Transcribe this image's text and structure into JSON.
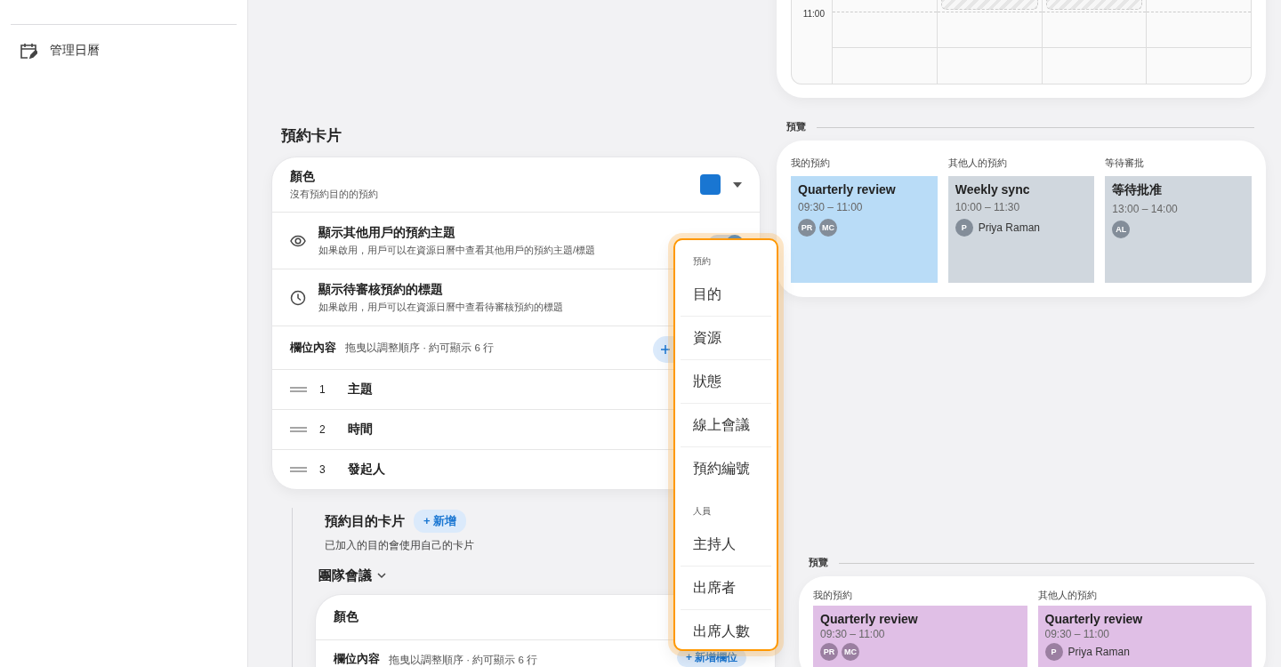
{
  "sidebar": {
    "items": [
      {
        "label": "管理日曆"
      }
    ]
  },
  "schedule": {
    "time_label": "11:00"
  },
  "booking_card": {
    "title": "預約卡片",
    "color_setting": {
      "label": "顏色",
      "description": "沒有預約目的的預約",
      "color": "#1976d2"
    },
    "toggles": [
      {
        "title": "顯示其他用戶的預約主題",
        "description": "如果啟用，用戶可以在資源日曆中查看其他用戶的預約主題/標題",
        "on": true
      },
      {
        "title": "顯示待審核預約的標題",
        "description": "如果啟用，用戶可以在資源日曆中查看待審核預約的標題"
      }
    ],
    "fields": {
      "label": "欄位內容",
      "hint": "拖曳以調整順序 · 約可顯示 6 行",
      "rows": [
        {
          "number": "1",
          "label": "主題"
        },
        {
          "number": "2",
          "label": "時間"
        },
        {
          "number": "3",
          "label": "發起人"
        }
      ]
    }
  },
  "purpose_cards": {
    "title": "預約目的卡片",
    "add_button": "+ 新增",
    "subtitle": "已加入的目的會使用自己的卡片",
    "group": {
      "label": "團隊會議",
      "expanded": true
    },
    "card": {
      "color_label": "顏色",
      "fields_label": "欄位內容",
      "fields_hint": "拖曳以調整順序 · 約可顯示 6 行",
      "add_field_button": "+ 新增欄位"
    }
  },
  "field_menu": {
    "sections": [
      {
        "header": "預約",
        "items": [
          "目的",
          "資源",
          "狀態",
          "線上會議",
          "預約編號"
        ]
      },
      {
        "header": "人員",
        "items": [
          "主持人",
          "出席者",
          "出席人數"
        ]
      }
    ]
  },
  "previews": [
    {
      "label": "預覽",
      "columns": [
        {
          "heading": "我的預約",
          "color": "#b9dcf7",
          "title": "Quarterly review",
          "time": "09:30 – 11:00",
          "avatars": [
            "PR",
            "MC"
          ]
        },
        {
          "heading": "其他人的預約",
          "color": "#d0d7de",
          "title": "Weekly sync",
          "time": "10:00 – 11:30",
          "avatars": [
            "P"
          ],
          "person": "Priya Raman"
        },
        {
          "heading": "等待審批",
          "color": "#d0d7de",
          "title": "等待批准",
          "time": "13:00 – 14:00",
          "avatars": [
            "AL"
          ]
        }
      ]
    },
    {
      "label": "預覽",
      "columns": [
        {
          "heading": "我的預約",
          "color": "#e0bfe6",
          "title": "Quarterly review",
          "time": "09:30 – 11:00",
          "avatars": [
            "PR",
            "MC"
          ]
        },
        {
          "heading": "其他人的預約",
          "color": "#e0bfe6",
          "title": "Quarterly review",
          "time": "09:30 – 11:00",
          "avatars": [
            "P"
          ],
          "person": "Priya Raman"
        }
      ]
    }
  ]
}
